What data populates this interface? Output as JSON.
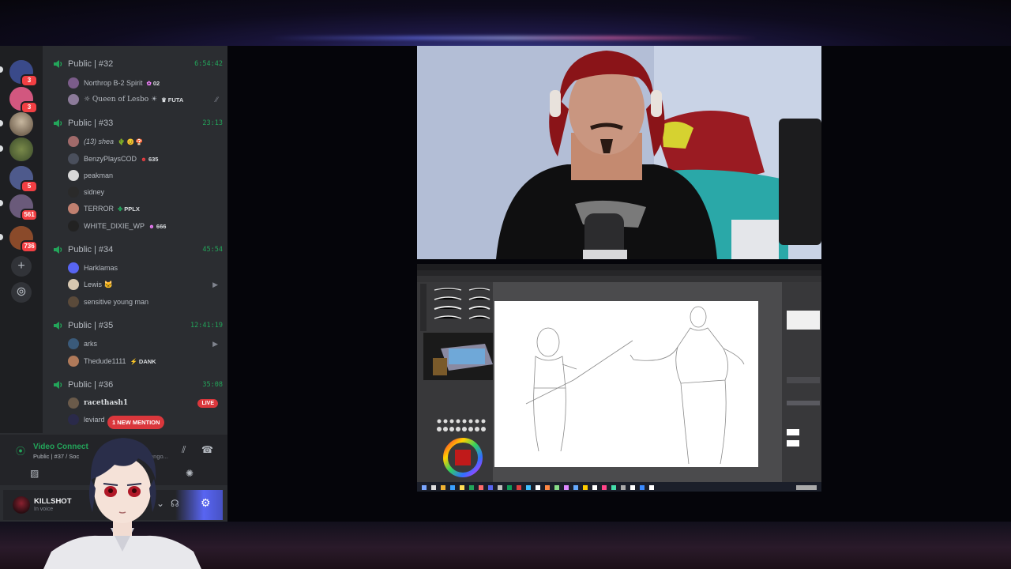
{
  "discord": {
    "servers": [
      {
        "name": "server-socialite",
        "badge": "3",
        "color": "#3a4a8a"
      },
      {
        "name": "server-pink",
        "badge": "3",
        "color": "#d2577f"
      },
      {
        "name": "server-portrait",
        "badge": "",
        "color": "#8a7a6a"
      },
      {
        "name": "server-landscape",
        "badge": "",
        "color": "#5b6b3e"
      },
      {
        "name": "server-group-a",
        "badge": "5",
        "color": "#4e5a8c"
      },
      {
        "name": "server-group-b",
        "badge": "561",
        "color": "#6a5a7a"
      },
      {
        "name": "server-group-c",
        "badge": "736",
        "color": "#8a4a2a"
      }
    ],
    "voice_channels": [
      {
        "name": "Public | #32",
        "timer": "6:54:42",
        "users": [
          {
            "name": "Northrop B-2 Spirit",
            "tag": "02",
            "tag_icon": "✿",
            "color": "#7b5c8a"
          },
          {
            "name": "☼ Queen of Lesbo ☀",
            "tag": "FUTA",
            "tag_icon": "♛",
            "color": "#8c7b9a",
            "trail": "⁄⁄"
          }
        ]
      },
      {
        "name": "Public | #33",
        "timer": "23:13",
        "users": [
          {
            "name": "(13) shea",
            "tag": "🌵 😊 🍄",
            "tag_icon": "",
            "color": "#a06a6a"
          },
          {
            "name": "BenzyPlaysCOD",
            "tag": "635",
            "tag_icon": "☻",
            "color": "#4a4f5c"
          },
          {
            "name": "peakman",
            "tag": "",
            "tag_icon": "",
            "color": "#d8d8d8"
          },
          {
            "name": "sidney",
            "tag": "",
            "tag_icon": "",
            "color": "#2a2a2a"
          },
          {
            "name": "TERROR",
            "tag": "PPLX",
            "tag_icon": "✤",
            "color": "#c08070"
          },
          {
            "name": "WHITE_DIXIE_WP",
            "tag": "666",
            "tag_icon": "☻",
            "color": "#222222"
          }
        ]
      },
      {
        "name": "Public | #34",
        "timer": "45:54",
        "users": [
          {
            "name": "Harklamas",
            "tag": "",
            "tag_icon": "",
            "color": "#5865f2"
          },
          {
            "name": "Lewis 🐱",
            "tag": "",
            "tag_icon": "",
            "color": "#d8c8b0",
            "trail": "▶"
          },
          {
            "name": "sensitive young man",
            "tag": "",
            "tag_icon": "",
            "color": "#5a4a3a"
          }
        ]
      },
      {
        "name": "Public | #35",
        "timer": "12:41:19",
        "users": [
          {
            "name": "arks",
            "tag": "",
            "tag_icon": "",
            "color": "#3a5a7a",
            "trail": "▶"
          },
          {
            "name": "Thedude1111",
            "tag": "DANK",
            "tag_icon": "⚡",
            "color": "#b07a5a"
          }
        ]
      },
      {
        "name": "Public | #36",
        "timer": "35:08",
        "users": [
          {
            "name": "racethash1",
            "tag": "",
            "tag_icon": "",
            "color": "#6a5a4a",
            "live": "LIVE"
          },
          {
            "name": "leviard",
            "tag": "",
            "tag_icon": "",
            "color": "#2a2a4a"
          }
        ]
      }
    ],
    "mention_pill": "1 NEW MENTION",
    "connection": {
      "title": "Video Connect",
      "subtitle": "Public | #37 / Soc",
      "subtitle_trail": "ango..."
    },
    "user": {
      "name": "KILLSHOT",
      "status": "In voice"
    }
  }
}
